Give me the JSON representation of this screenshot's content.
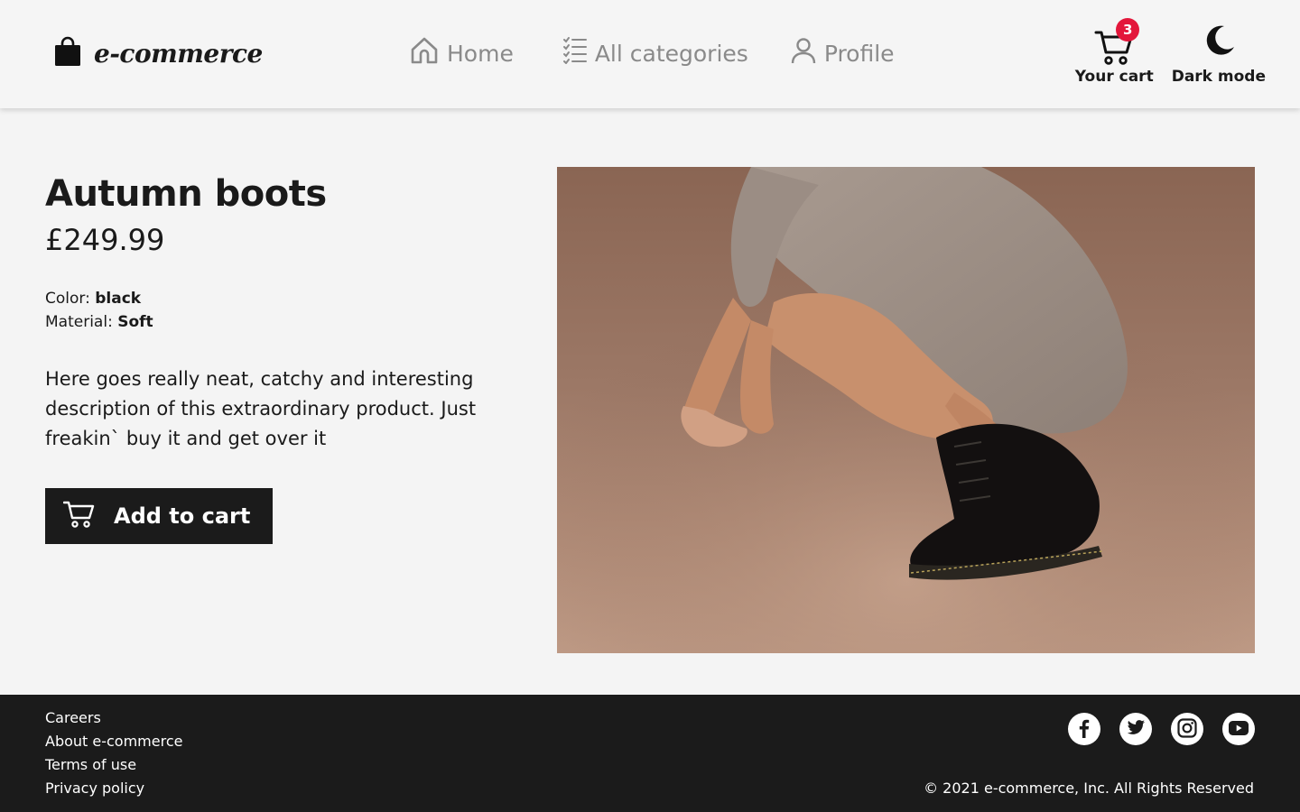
{
  "brand": {
    "name": "e-commerce",
    "icon": "shopping-bag-icon"
  },
  "nav": {
    "items": [
      {
        "label": "Home",
        "icon": "home-icon"
      },
      {
        "label": "All categories",
        "icon": "list-icon"
      },
      {
        "label": "Profile",
        "icon": "user-icon"
      }
    ]
  },
  "header_actions": {
    "cart": {
      "label": "Your cart",
      "count": "3",
      "icon": "cart-icon"
    },
    "dark_mode": {
      "label": "Dark mode",
      "icon": "moon-icon"
    }
  },
  "product": {
    "title": "Autumn boots",
    "price": "£249.99",
    "color_label": "Color:",
    "color_value": "black",
    "material_label": "Material:",
    "material_value": "Soft",
    "description": "Here goes really neat, catchy and interesting description of this extraordinary product. Just freakin` buy it and get over it",
    "add_to_cart_label": "Add to cart",
    "image": "photo-woman-squatting-in-black-boots"
  },
  "footer": {
    "links": [
      "Careers",
      "About e-commerce",
      "Terms of use",
      "Privacy policy"
    ],
    "socials": [
      "facebook-icon",
      "twitter-icon",
      "instagram-icon",
      "youtube-icon"
    ],
    "copyright": "© 2021 e-commerce, Inc. All Rights Reserved"
  },
  "colors": {
    "background": "#f4f4f4",
    "dark": "#1b1b1b",
    "badge": "#e3173b",
    "muted": "#8a8a8a"
  }
}
